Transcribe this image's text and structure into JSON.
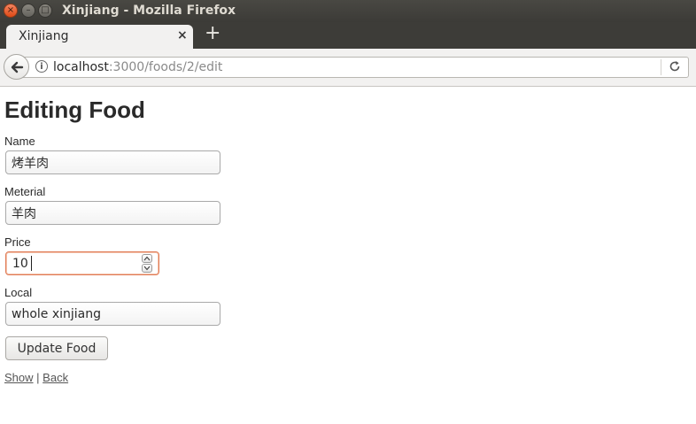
{
  "window": {
    "title": "Xinjiang - Mozilla Firefox",
    "buttons": {
      "close": "×",
      "minimize": "–",
      "maximize": "□"
    }
  },
  "tabs": [
    {
      "label": "Xinjiang",
      "close": "×"
    }
  ],
  "new_tab": "+",
  "address_bar": {
    "host": "localhost",
    "path": ":3000/foods/2/edit"
  },
  "page": {
    "heading": "Editing Food",
    "fields": [
      {
        "label": "Name",
        "value": "烤羊肉"
      },
      {
        "label": "Meterial",
        "value": "羊肉"
      },
      {
        "label": "Price",
        "value": "10"
      },
      {
        "label": "Local",
        "value": "whole xinjiang"
      }
    ],
    "submit_label": "Update Food",
    "links": {
      "show": "Show",
      "separator": "|",
      "back": "Back"
    }
  }
}
